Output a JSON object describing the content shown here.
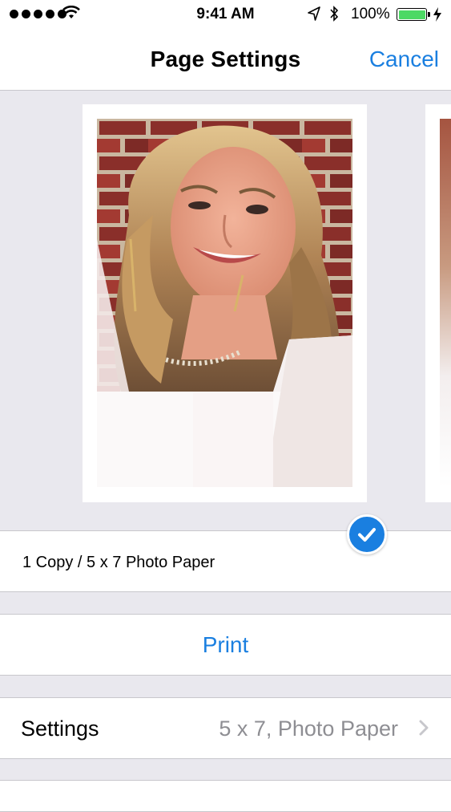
{
  "status_bar": {
    "time": "9:41 AM",
    "battery_percent": "100%",
    "battery_level": 1.0,
    "signal_bars": 5,
    "battery_color": "#4cd964"
  },
  "nav": {
    "title": "Page Settings",
    "cancel_label": "Cancel"
  },
  "job": {
    "summary": "1 Copy / 5 x 7 Photo Paper",
    "selected": true
  },
  "actions": {
    "print_label": "Print"
  },
  "settings": {
    "label": "Settings",
    "value": "5 x 7, Photo Paper"
  },
  "colors": {
    "accent": "#1a7fe0",
    "secondary_text": "#8e8e93",
    "group_background": "#e9e8ee"
  },
  "icons": {
    "check": "checkmark-icon",
    "chevron": "chevron-right-icon",
    "location": "location-arrow-icon",
    "bluetooth": "bluetooth-icon",
    "wifi": "wifi-icon",
    "charging": "bolt-icon"
  }
}
